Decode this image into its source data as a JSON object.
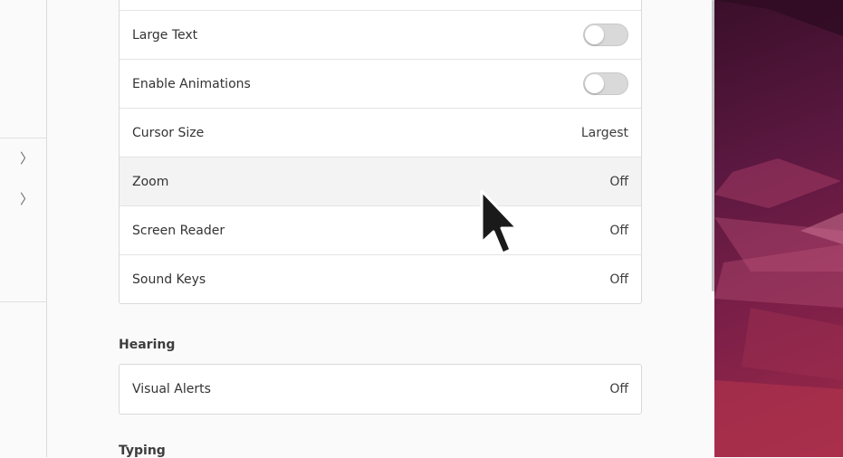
{
  "seeing": {
    "rows": [
      {
        "label": "Large Text",
        "type": "toggle",
        "state": false
      },
      {
        "label": "Enable Animations",
        "type": "toggle",
        "state": false
      },
      {
        "label": "Cursor Size",
        "value": "Largest"
      },
      {
        "label": "Zoom",
        "value": "Off"
      },
      {
        "label": "Screen Reader",
        "value": "Off"
      },
      {
        "label": "Sound Keys",
        "value": "Off"
      }
    ]
  },
  "hearing": {
    "title": "Hearing",
    "rows": [
      {
        "label": "Visual Alerts",
        "value": "Off"
      }
    ]
  },
  "typing": {
    "title": "Typing"
  },
  "icons": {
    "chevron": "chevron-right-icon",
    "cursor": "mouse-pointer-icon"
  },
  "colors": {
    "wallpaper_dark": "#3a0f2a",
    "wallpaper_light": "#9e2a48",
    "toggle_off": "#d9d9d9"
  }
}
